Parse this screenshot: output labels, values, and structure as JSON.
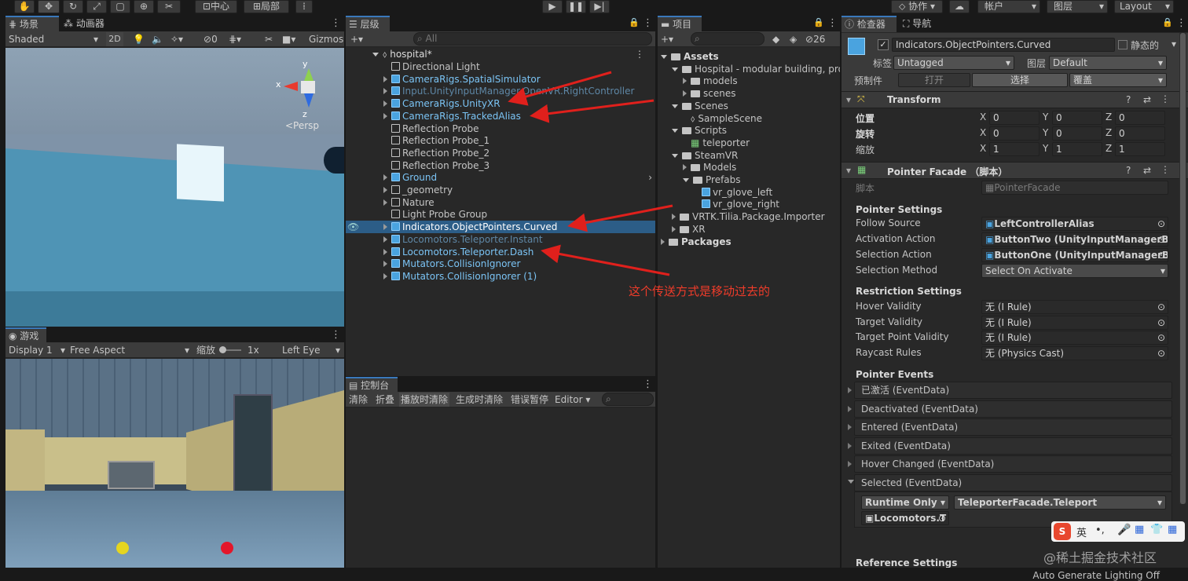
{
  "toolbar": {
    "pivot": "中心",
    "space": "局部",
    "collab": "协作",
    "account": "帐户",
    "layers": "图层",
    "layout": "Layout"
  },
  "scene": {
    "tab": "场景",
    "tab2": "动画器",
    "shading": "Shaded",
    "mode2d": "2D",
    "gizmos": "Gizmos",
    "persp": "<Persp",
    "axis_y": "y",
    "axis_x": "x",
    "axis_z": "z",
    "hidden_count": "0"
  },
  "game": {
    "tab": "游戏",
    "display": "Display 1",
    "aspect": "Free Aspect",
    "scale_label": "缩放",
    "scale_val": "1x",
    "eye": "Left Eye"
  },
  "hierarchy": {
    "tab": "层级",
    "search_placeholder": "All",
    "root": "hospital*",
    "items": [
      {
        "label": "Directional Light",
        "style": "normal"
      },
      {
        "label": "CameraRigs.SpatialSimulator",
        "style": "blue"
      },
      {
        "label": "Input.UnityInputManager.OpenVR.RightController",
        "style": "dim"
      },
      {
        "label": "CameraRigs.UnityXR",
        "style": "blue"
      },
      {
        "label": "CameraRigs.TrackedAlias",
        "style": "blue"
      },
      {
        "label": "Reflection Probe",
        "style": "normal"
      },
      {
        "label": "Reflection Probe_1",
        "style": "normal"
      },
      {
        "label": "Reflection Probe_2",
        "style": "normal"
      },
      {
        "label": "Reflection Probe_3",
        "style": "normal"
      },
      {
        "label": "Ground",
        "style": "blue"
      },
      {
        "label": "_geometry",
        "style": "normal"
      },
      {
        "label": "Nature",
        "style": "normal"
      },
      {
        "label": "Light Probe Group",
        "style": "normal"
      },
      {
        "label": "Indicators.ObjectPointers.Curved",
        "style": "selected"
      },
      {
        "label": "Locomotors.Teleporter.Instant",
        "style": "dim"
      },
      {
        "label": "Locomotors.Teleporter.Dash",
        "style": "blue"
      },
      {
        "label": "Mutators.CollisionIgnorer",
        "style": "blue"
      },
      {
        "label": "Mutators.CollisionIgnorer (1)",
        "style": "blue"
      }
    ],
    "annotation": "这个传送方式是移动过去的"
  },
  "console": {
    "tab": "控制台",
    "buttons": [
      "清除",
      "折叠",
      "播放时清除",
      "生成时清除",
      "错误暂停",
      "Editor"
    ]
  },
  "project": {
    "tab": "项目",
    "hidden_count": "26",
    "items": [
      {
        "label": "Assets",
        "depth": 0,
        "kind": "folder",
        "open": true
      },
      {
        "label": "Hospital - modular building, pro",
        "depth": 1,
        "kind": "folder",
        "open": true
      },
      {
        "label": "models",
        "depth": 2,
        "kind": "folder"
      },
      {
        "label": "scenes",
        "depth": 2,
        "kind": "folder"
      },
      {
        "label": "Scenes",
        "depth": 1,
        "kind": "folder",
        "open": true
      },
      {
        "label": "SampleScene",
        "depth": 2,
        "kind": "scene"
      },
      {
        "label": "Scripts",
        "depth": 1,
        "kind": "folder",
        "open": true
      },
      {
        "label": "teleporter",
        "depth": 2,
        "kind": "script"
      },
      {
        "label": "SteamVR",
        "depth": 1,
        "kind": "folder",
        "open": true
      },
      {
        "label": "Models",
        "depth": 2,
        "kind": "folder"
      },
      {
        "label": "Prefabs",
        "depth": 2,
        "kind": "folder",
        "open": true
      },
      {
        "label": "vr_glove_left",
        "depth": 3,
        "kind": "prefab"
      },
      {
        "label": "vr_glove_right",
        "depth": 3,
        "kind": "prefab"
      },
      {
        "label": "VRTK.Tilia.Package.Importer",
        "depth": 1,
        "kind": "folder"
      },
      {
        "label": "XR",
        "depth": 1,
        "kind": "folder"
      },
      {
        "label": "Packages",
        "depth": 0,
        "kind": "folder"
      }
    ]
  },
  "inspector": {
    "tab": "检查器",
    "tab2": "导航",
    "object_name": "Indicators.ObjectPointers.Curved",
    "static": "静态的",
    "tag_label": "标签",
    "tag": "Untagged",
    "layer_label": "图层",
    "layer": "Default",
    "prefab_label": "预制件",
    "open": "打开",
    "select": "选择",
    "override": "覆盖",
    "transform": {
      "title": "Transform",
      "pos": "位置",
      "rot": "旋转",
      "scale": "缩放",
      "pos_vals": [
        "0",
        "0",
        "0"
      ],
      "rot_vals": [
        "0",
        "0",
        "0"
      ],
      "scale_vals": [
        "1",
        "1",
        "1"
      ]
    },
    "pointer": {
      "title": "Pointer Facade （脚本）",
      "script_label": "脚本",
      "script": "PointerFacade",
      "settings": "Pointer Settings",
      "follow_label": "Follow Source",
      "follow": "LeftControllerAlias",
      "activation_label": "Activation Action",
      "activation": "ButtonTwo (UnityInputManagerBu",
      "selection_label": "Selection Action",
      "selection": "ButtonOne (UnityInputManagerBu",
      "method_label": "Selection Method",
      "method": "Select On Activate",
      "restriction": "Restriction Settings",
      "hover_label": "Hover Validity",
      "hover": "无 (I Rule)",
      "target_label": "Target Validity",
      "target": "无 (I Rule)",
      "tpoint_label": "Target Point Validity",
      "tpoint": "无 (I Rule)",
      "ray_label": "Raycast Rules",
      "ray": "无 (Physics Cast)",
      "events": "Pointer Events",
      "event_list": [
        "已激活 (EventData)",
        "Deactivated (EventData)",
        "Entered (EventData)",
        "Exited (EventData)",
        "Hover Changed (EventData)",
        "Selected (EventData)"
      ],
      "runtime": "Runtime Only",
      "func": "TeleporterFacade.Teleport",
      "obj": "Locomotors.T",
      "reference": "Reference Settings"
    }
  },
  "status": {
    "lighting": "Auto Generate Lighting Off",
    "watermark": "@稀土掘金技术社区",
    "ime": "英"
  }
}
